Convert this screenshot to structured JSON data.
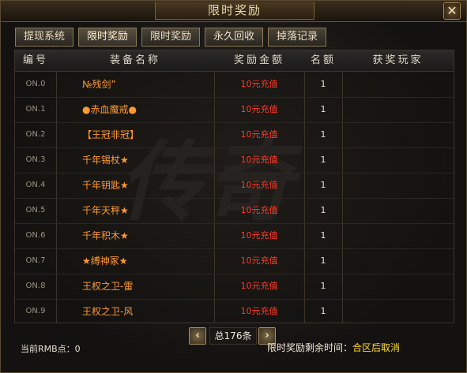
{
  "window": {
    "title": "限时奖励",
    "close_glyph": "✕"
  },
  "tabs": [
    {
      "label": "提现系统"
    },
    {
      "label": "限时奖励"
    },
    {
      "label": "限时奖励"
    },
    {
      "label": "永久回收"
    },
    {
      "label": "掉落记录"
    }
  ],
  "table": {
    "headers": {
      "no": "编号",
      "name": "装备名称",
      "reward": "奖励金额",
      "quantity": "名额",
      "winner": "获奖玩家"
    },
    "rows": [
      {
        "no": "ON.0",
        "name": "№残剑”",
        "reward": "10元充值",
        "quantity": "1",
        "winner": ""
      },
      {
        "no": "ON.1",
        "name": "●赤血魔戒●",
        "reward": "10元充值",
        "quantity": "1",
        "winner": ""
      },
      {
        "no": "ON.2",
        "name": "【王冠非冠】",
        "reward": "10元充值",
        "quantity": "1",
        "winner": ""
      },
      {
        "no": "ON.3",
        "name": "千年锡杖★",
        "reward": "10元充值",
        "quantity": "1",
        "winner": ""
      },
      {
        "no": "ON.4",
        "name": "千年钥匙★",
        "reward": "10元充值",
        "quantity": "1",
        "winner": ""
      },
      {
        "no": "ON.5",
        "name": "千年天秤★",
        "reward": "10元充值",
        "quantity": "1",
        "winner": ""
      },
      {
        "no": "ON.6",
        "name": "千年积木★",
        "reward": "10元充值",
        "quantity": "1",
        "winner": ""
      },
      {
        "no": "ON.7",
        "name": "★缚神冢★",
        "reward": "10元充值",
        "quantity": "1",
        "winner": ""
      },
      {
        "no": "ON.8",
        "name": "王权之卫-雷",
        "reward": "10元充值",
        "quantity": "1",
        "winner": ""
      },
      {
        "no": "ON.9",
        "name": "王权之卫-风",
        "reward": "10元充值",
        "quantity": "1",
        "winner": ""
      }
    ]
  },
  "pager": {
    "prev_glyph": "‹",
    "next_glyph": "›",
    "total": "总176条"
  },
  "footer": {
    "rmb_points": "当前RMB点：0",
    "time_label": "限时奖励剩余时间：",
    "time_value": "合区后取消"
  },
  "watermark": {
    "text": "传奇"
  },
  "colors": {
    "item_name": "#ff9a30",
    "reward": "#ff3a28",
    "highlight": "#ffdc30"
  }
}
